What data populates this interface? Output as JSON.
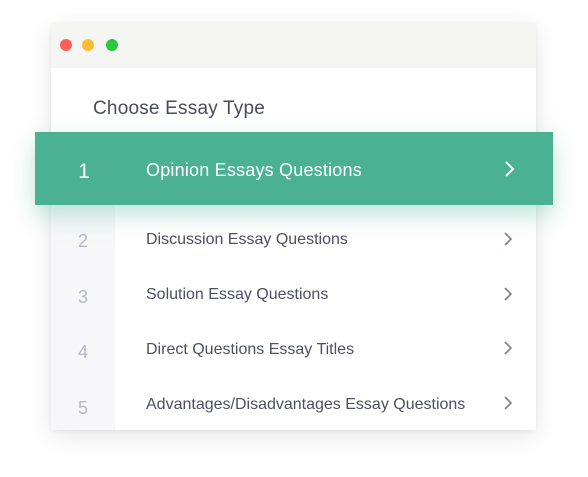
{
  "window": {
    "controls": [
      "close",
      "minimize",
      "maximize"
    ]
  },
  "heading": "Choose Essay Type",
  "accent_color": "#4ab193",
  "essay_types": [
    {
      "number": "1",
      "label": "Opinion Essays Questions",
      "selected": true
    },
    {
      "number": "2",
      "label": "Discussion Essay Questions",
      "selected": false
    },
    {
      "number": "3",
      "label": "Solution Essay Questions",
      "selected": false
    },
    {
      "number": "4",
      "label": "Direct Questions Essay Titles",
      "selected": false
    },
    {
      "number": "5",
      "label": "Advantages/Disadvantages Essay Questions",
      "selected": false
    }
  ],
  "icons": {
    "row_chevron": "chevron-right-icon"
  }
}
